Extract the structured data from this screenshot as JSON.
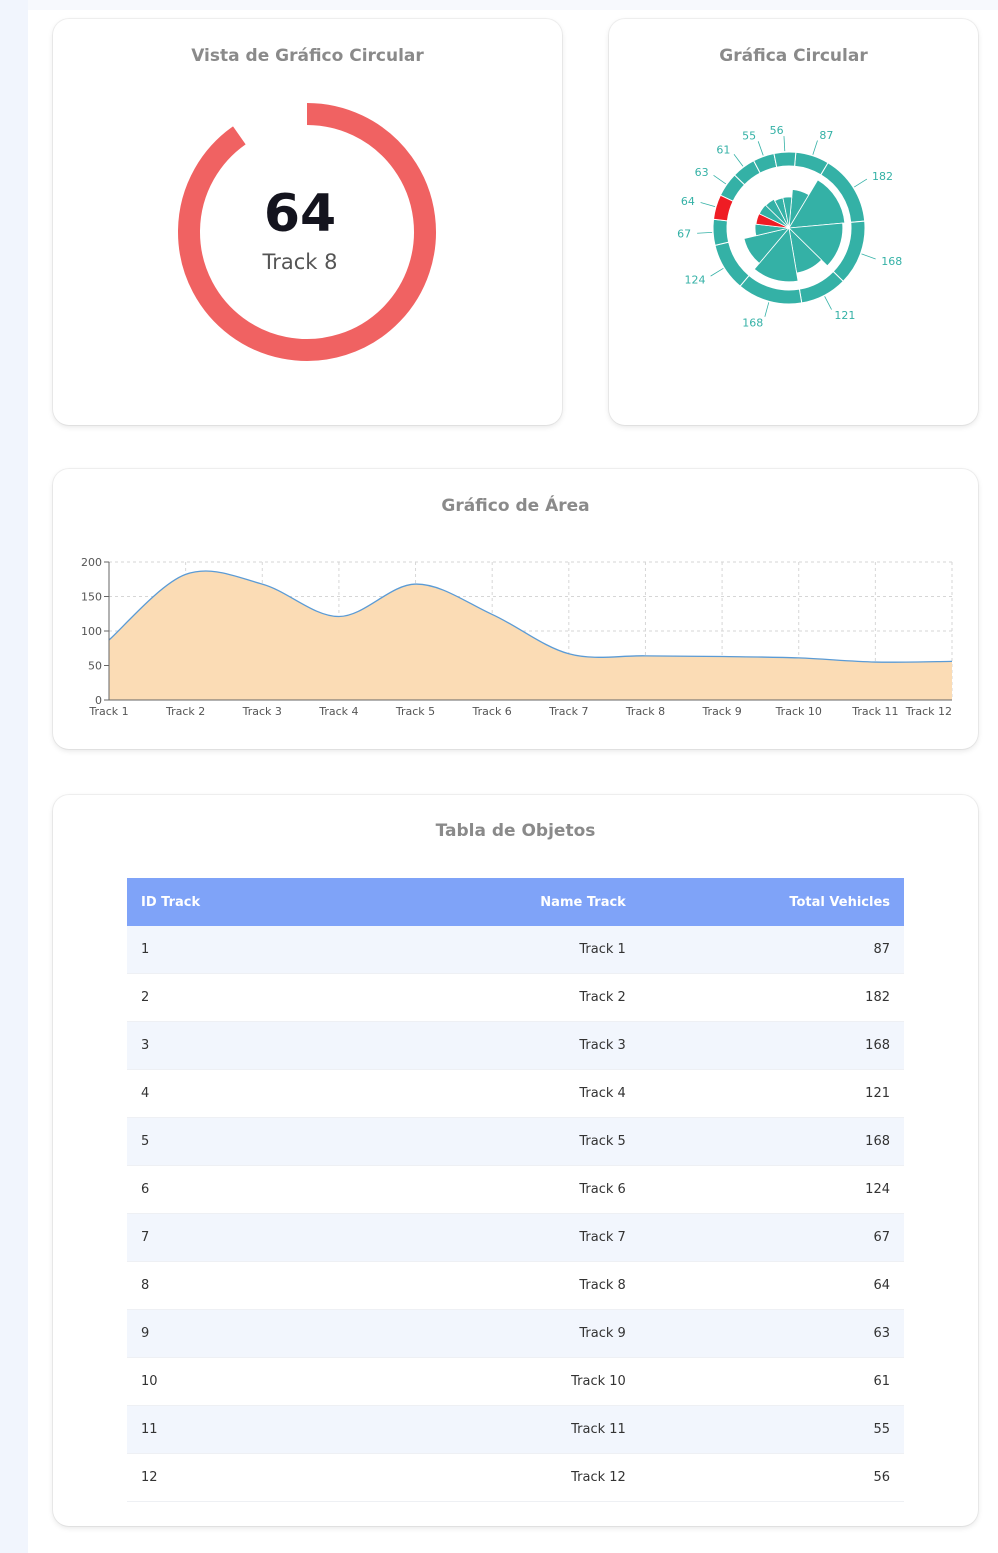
{
  "gauge_card": {
    "title": "Vista de Gráfico Circular",
    "value": "64",
    "label": "Track 8",
    "color": "#f06262"
  },
  "rose_card": {
    "title": "Gráfica Circular"
  },
  "area_card": {
    "title": "Gráfico de Área"
  },
  "table_card": {
    "title": "Tabla de Objetos",
    "columns": [
      "ID Track",
      "Name Track",
      "Total Vehicles"
    ],
    "rows": [
      [
        "1",
        "Track 1",
        "87"
      ],
      [
        "2",
        "Track 2",
        "182"
      ],
      [
        "3",
        "Track 3",
        "168"
      ],
      [
        "4",
        "Track 4",
        "121"
      ],
      [
        "5",
        "Track 5",
        "168"
      ],
      [
        "6",
        "Track 6",
        "124"
      ],
      [
        "7",
        "Track 7",
        "67"
      ],
      [
        "8",
        "Track 8",
        "64"
      ],
      [
        "9",
        "Track 9",
        "63"
      ],
      [
        "10",
        "Track 10",
        "61"
      ],
      [
        "11",
        "Track 11",
        "55"
      ],
      [
        "12",
        "Track 12",
        "56"
      ]
    ],
    "header_color": "#7fa3f8"
  },
  "chart_data": [
    {
      "type": "pie",
      "title": "Gráfica Circular",
      "categories": [
        "Track 1",
        "Track 2",
        "Track 3",
        "Track 4",
        "Track 5",
        "Track 6",
        "Track 7",
        "Track 8",
        "Track 9",
        "Track 10",
        "Track 11",
        "Track 12"
      ],
      "values": [
        87,
        182,
        168,
        121,
        168,
        124,
        67,
        64,
        63,
        61,
        55,
        56
      ],
      "highlighted": "Track 8",
      "colors": {
        "base": "#34b1a6",
        "highlight": "#ef1c24"
      }
    },
    {
      "type": "area",
      "title": "Gráfico de Área",
      "categories": [
        "Track 1",
        "Track 2",
        "Track 3",
        "Track 4",
        "Track 5",
        "Track 6",
        "Track 7",
        "Track 8",
        "Track 9",
        "Track 10",
        "Track 11",
        "Track 12"
      ],
      "values": [
        87,
        182,
        168,
        121,
        168,
        124,
        67,
        64,
        63,
        61,
        55,
        56
      ],
      "y_ticks": [
        0,
        50,
        100,
        150,
        200
      ],
      "ylim": [
        0,
        200
      ],
      "grid": true,
      "colors": {
        "fill": "#fbdcb5",
        "line": "#5b9bd5"
      }
    }
  ]
}
